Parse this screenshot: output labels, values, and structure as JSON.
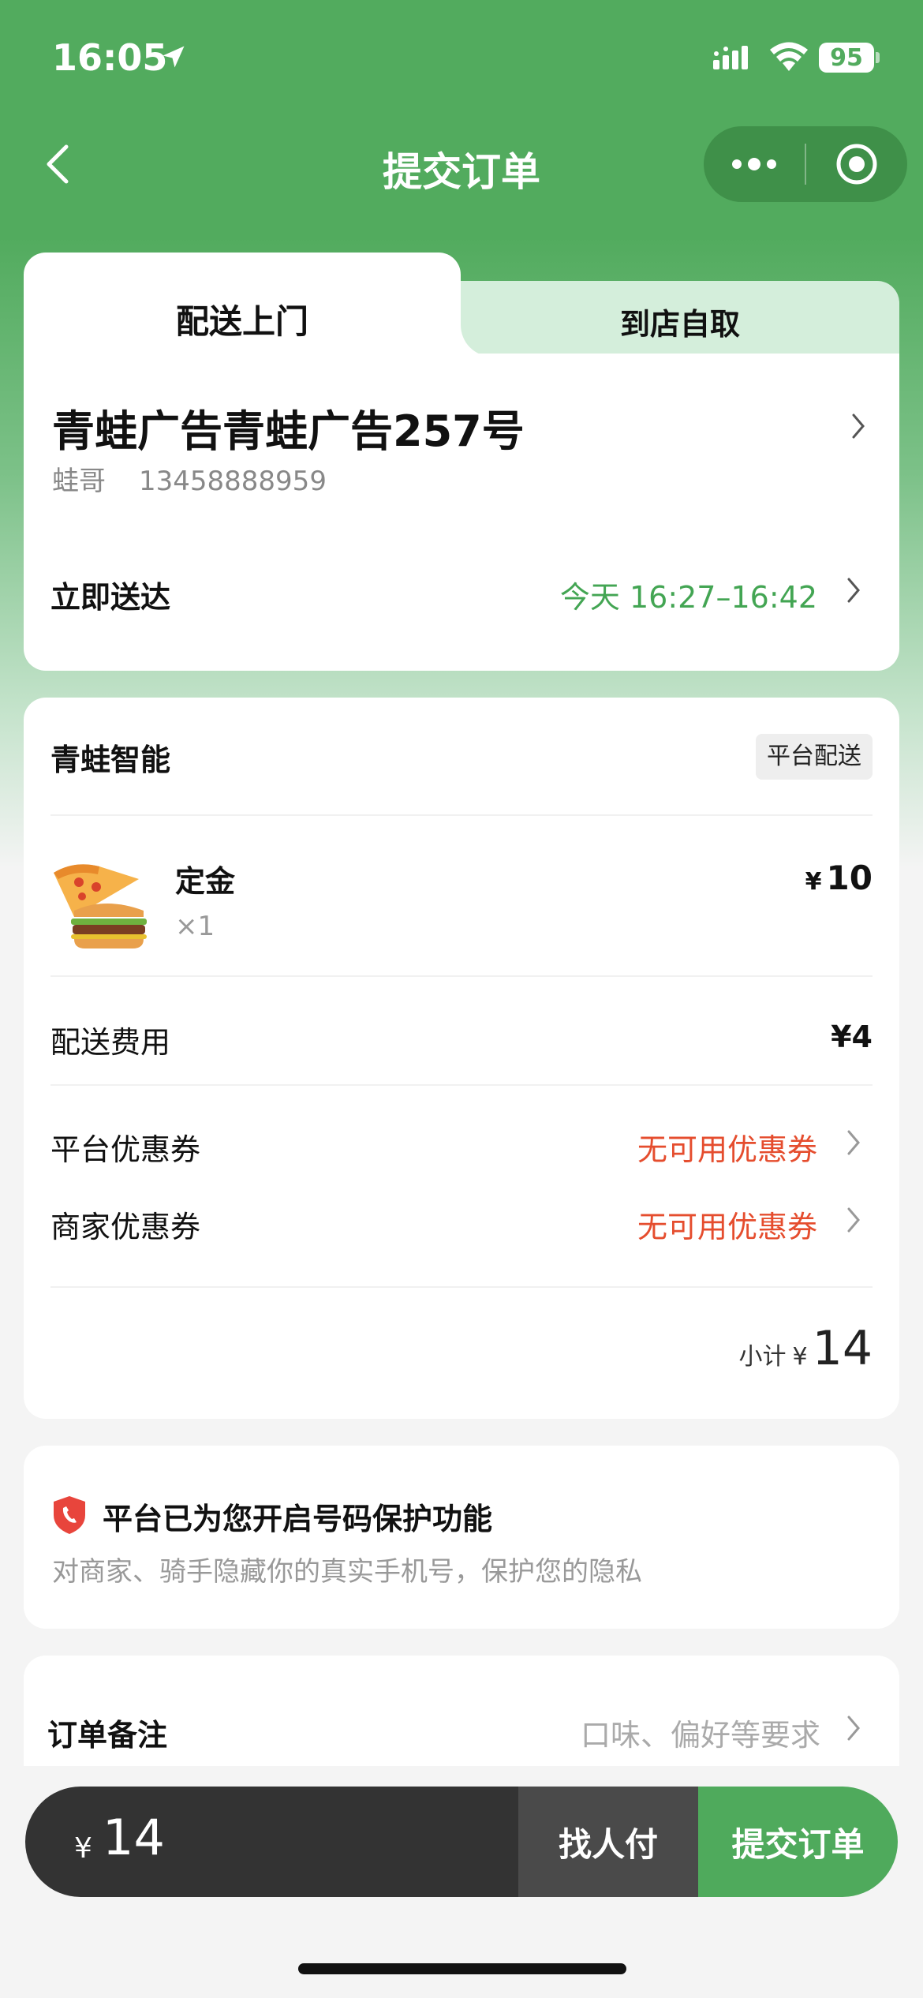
{
  "status_bar": {
    "time": "16:05",
    "battery": "95"
  },
  "nav": {
    "title": "提交订单"
  },
  "tabs": {
    "delivery": "配送上门",
    "pickup": "到店自取"
  },
  "address": {
    "title": "青蛙广告青蛙广告257号",
    "name": "蛙哥",
    "phone": "13458888959",
    "delivery_label": "立即送达",
    "delivery_time": "今天 16:27–16:42"
  },
  "order": {
    "store_name": "青蛙智能",
    "delivery_badge": "平台配送",
    "item": {
      "name": "定金",
      "qty": "×1",
      "currency": "¥",
      "price": "10"
    },
    "delivery_fee_label": "配送费用",
    "delivery_fee": "¥4",
    "platform_coupon_label": "平台优惠券",
    "platform_coupon_value": "无可用优惠券",
    "merchant_coupon_label": "商家优惠券",
    "merchant_coupon_value": "无可用优惠券",
    "subtotal_label": "小计",
    "subtotal_currency": "¥",
    "subtotal": "14"
  },
  "privacy": {
    "title": "平台已为您开启号码保护功能",
    "desc": "对商家、骑手隐藏你的真实手机号，保护您的隐私"
  },
  "note": {
    "label": "订单备注",
    "placeholder": "口味、偏好等要求"
  },
  "bottom_bar": {
    "currency": "¥",
    "total": "14",
    "pay_for_me": "找人付",
    "submit": "提交订单"
  },
  "colors": {
    "brand_green": "#52ab5e",
    "accent_red": "#e54d2e",
    "time_green": "#43a553"
  }
}
